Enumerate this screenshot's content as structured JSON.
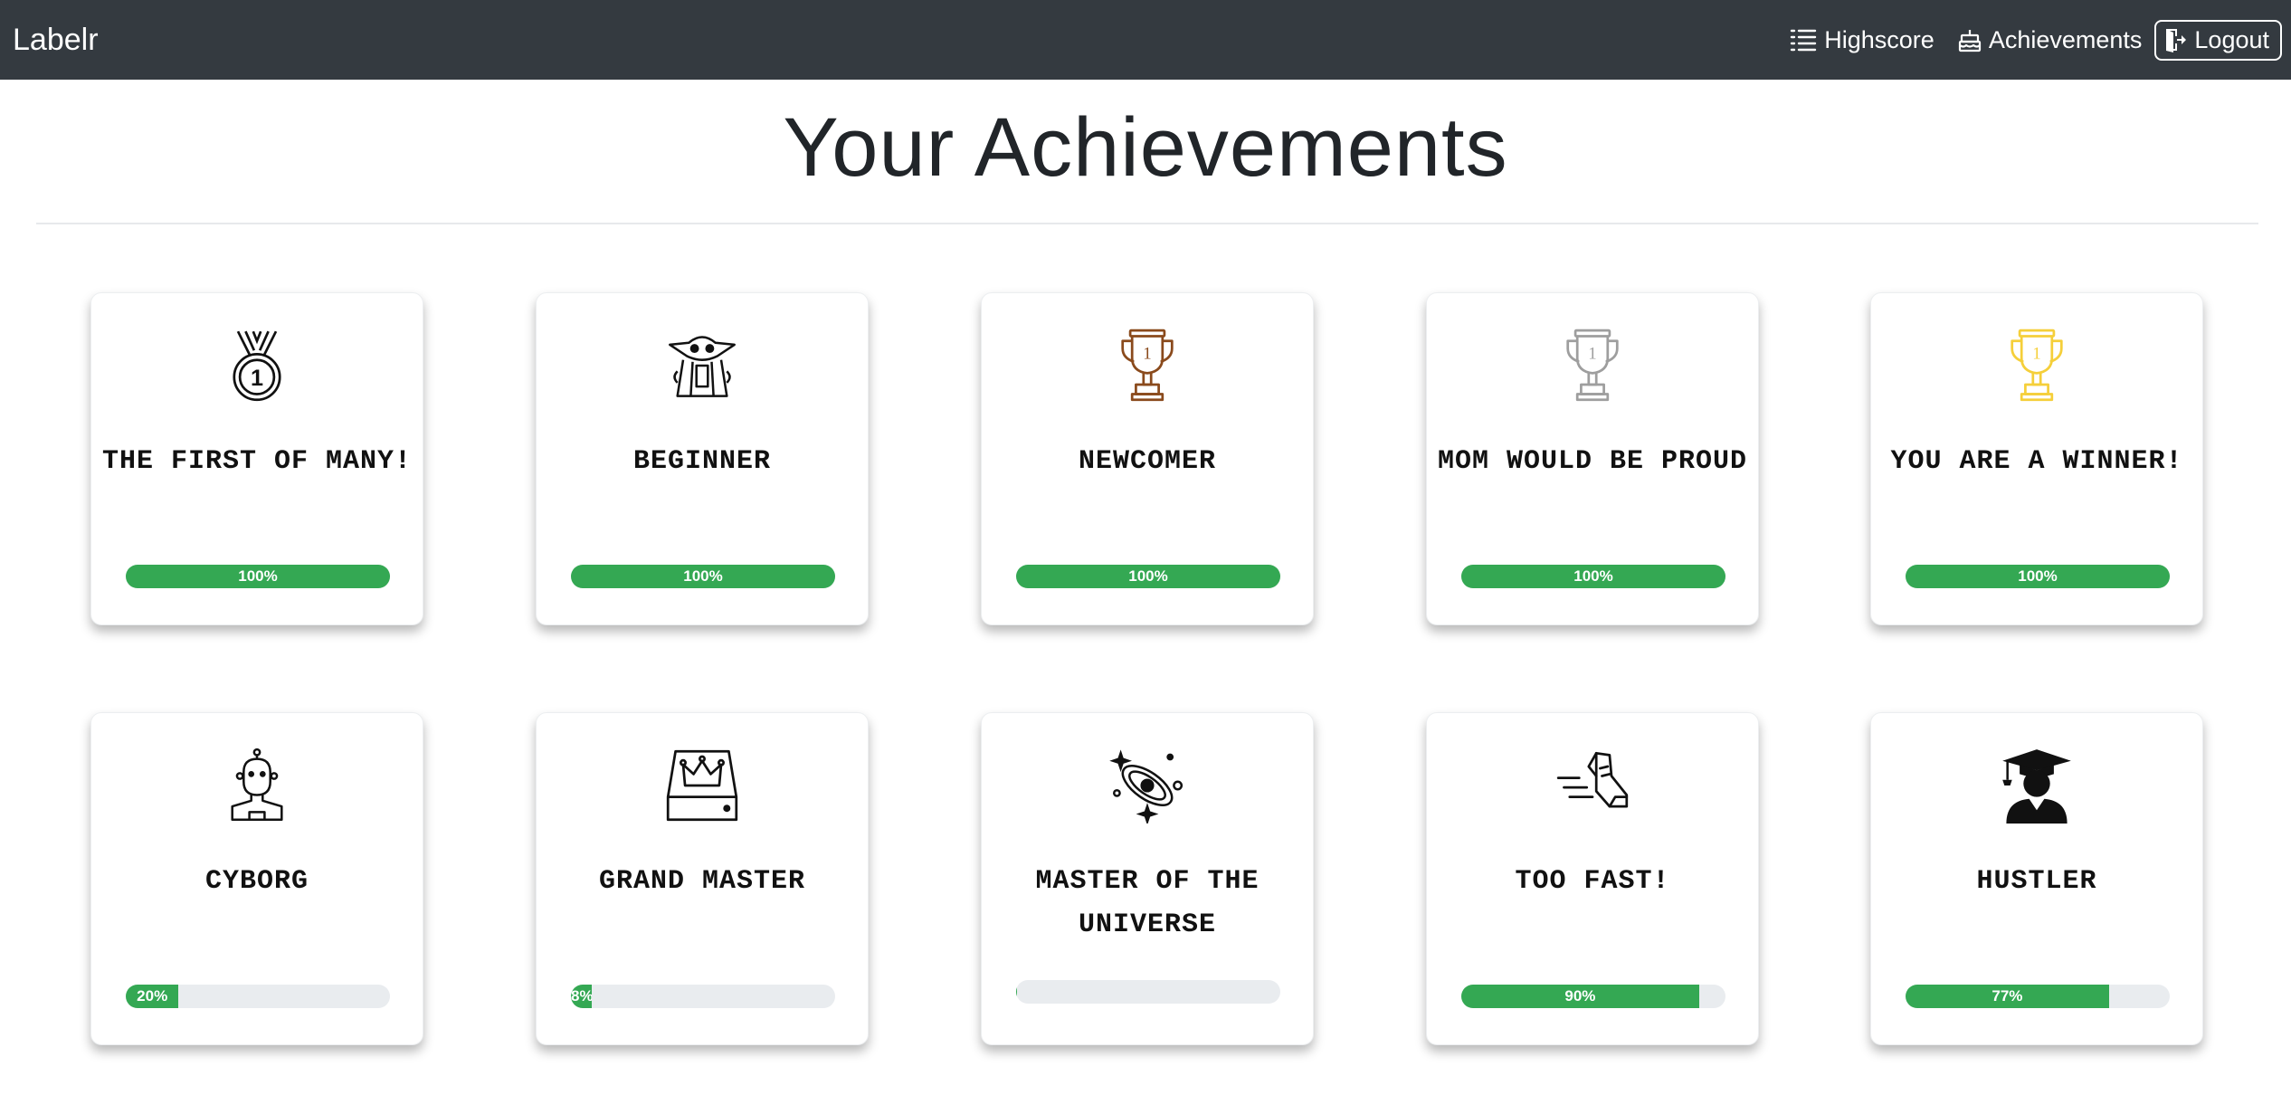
{
  "navbar": {
    "brand": "Labelr",
    "links": [
      {
        "label": "Highscore",
        "icon": "list-icon"
      },
      {
        "label": "Achievements",
        "icon": "cake-icon"
      },
      {
        "label": "Logout",
        "icon": "logout-icon"
      }
    ]
  },
  "page": {
    "title": "Your Achievements"
  },
  "colors": {
    "navbar": "#343a40",
    "progress": "#34a853",
    "bronze": "#8a4a1c",
    "silver": "#9e9e9e",
    "gold": "#f5cf3a"
  },
  "achievements": [
    {
      "title": "THE FIRST OF MANY!",
      "progress": 100,
      "progress_label": "100%",
      "icon": "medal-icon"
    },
    {
      "title": "BEGINNER",
      "progress": 100,
      "progress_label": "100%",
      "icon": "baby-yoda-icon"
    },
    {
      "title": "NEWCOMER",
      "progress": 100,
      "progress_label": "100%",
      "icon": "bronze-trophy-icon"
    },
    {
      "title": "MOM WOULD BE PROUD",
      "progress": 100,
      "progress_label": "100%",
      "icon": "silver-trophy-icon"
    },
    {
      "title": "YOU ARE A WINNER!",
      "progress": 100,
      "progress_label": "100%",
      "icon": "gold-trophy-icon"
    },
    {
      "title": "CYBORG",
      "progress": 20,
      "progress_label": "20%",
      "icon": "cyborg-icon"
    },
    {
      "title": "GRAND MASTER",
      "progress": 8,
      "progress_label": "8%",
      "icon": "crown-drive-icon"
    },
    {
      "title": "MASTER OF THE UNIVERSE",
      "progress": 0.5,
      "progress_label": "",
      "icon": "galaxy-icon"
    },
    {
      "title": "TOO FAST!",
      "progress": 90,
      "progress_label": "90%",
      "icon": "running-shoe-icon"
    },
    {
      "title": "HUSTLER",
      "progress": 77,
      "progress_label": "77%",
      "icon": "graduate-icon"
    }
  ]
}
